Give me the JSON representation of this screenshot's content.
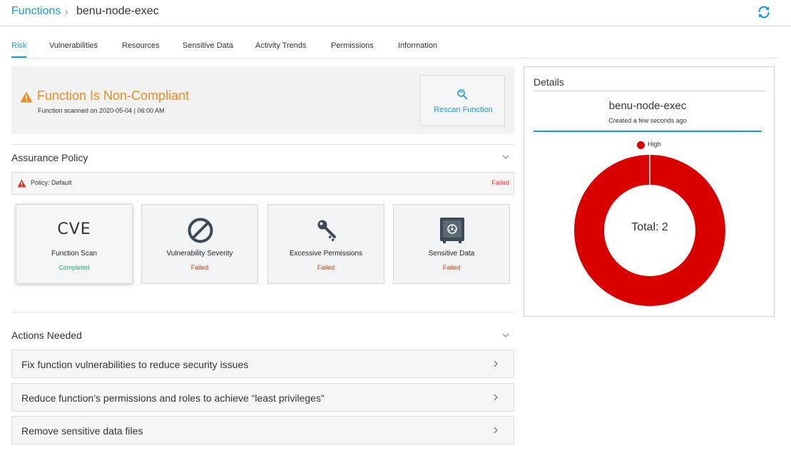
{
  "breadcrumb": {
    "root": "Functions",
    "separator": "›",
    "current": "benu-node-exec"
  },
  "icons": {
    "refresh": "refresh-icon",
    "warning": "warning-icon",
    "rescan": "rescan-icon"
  },
  "colors": {
    "accent": "#1a9bd7",
    "warning": "#f08a24",
    "failed": "#e0301e",
    "completed": "#2fae6d",
    "high": "#d90000"
  },
  "tabs": [
    {
      "label": "Risk",
      "active": true
    },
    {
      "label": "Vulnerabilities"
    },
    {
      "label": "Resources"
    },
    {
      "label": "Sensitive Data"
    },
    {
      "label": "Activity Trends"
    },
    {
      "label": "Permissions"
    },
    {
      "label": "Information"
    }
  ],
  "banner": {
    "title": "Function Is Non-Compliant",
    "subtitle": "Function scanned on 2020-05-04 | 06:00 AM",
    "rescan_label": "Rescan Function"
  },
  "assurance": {
    "title": "Assurance Policy",
    "policy_label": "Policy: Default",
    "policy_status": "Failed",
    "cards": [
      {
        "name": "Function Scan",
        "status": "Completed",
        "icon": "cve-icon",
        "icon_text": "CVE"
      },
      {
        "name": "Vulnerability Severity",
        "status": "Failed",
        "icon": "prohibited-icon"
      },
      {
        "name": "Excessive Permissions",
        "status": "Failed",
        "icon": "key-icon"
      },
      {
        "name": "Sensitive Data",
        "status": "Failed",
        "icon": "safe-icon"
      }
    ]
  },
  "actions": {
    "title": "Actions Needed",
    "items": [
      "Fix function vulnerabilities to reduce security issues",
      "Reduce function’s permissions and roles to achieve “least privileges”",
      "Remove sensitive data files"
    ]
  },
  "details": {
    "title": "Details",
    "name": "benu-node-exec",
    "created": "Created a few seconds ago",
    "total_label": "Total: 2"
  },
  "chart_data": {
    "type": "pie",
    "categories": [
      "High"
    ],
    "values": [
      2
    ],
    "colors": [
      "#d90000"
    ],
    "legend": "top",
    "total": 2
  }
}
